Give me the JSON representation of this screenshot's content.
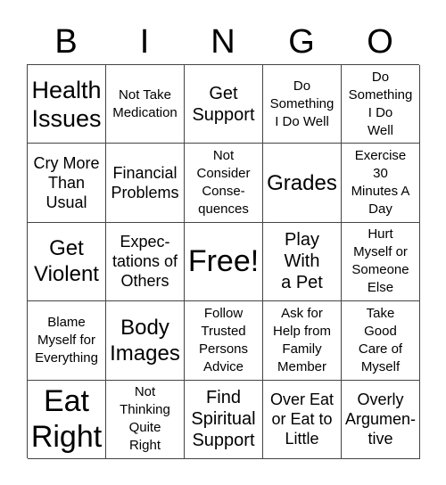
{
  "header": {
    "letters": [
      "B",
      "I",
      "N",
      "G",
      "O"
    ]
  },
  "grid": {
    "rows": [
      [
        "Health\nIssues",
        "Not Take\nMedication",
        "Get\nSupport",
        "Do\nSomething\nI Do Well",
        "Do\nSomething\nI Do\nWell"
      ],
      [
        "Cry More\nThan\nUsual",
        "Financial\nProblems",
        "Not\nConsider\nConse-\nquences",
        "Grades",
        "Exercise\n30\nMinutes A\nDay"
      ],
      [
        "Get\nViolent",
        "Expec-\ntations of\nOthers",
        "Free!",
        "Play\nWith\na Pet",
        "Hurt\nMyself or\nSomeone\nElse"
      ],
      [
        "Blame\nMyself for\nEverything",
        "Body\nImages",
        "Follow\nTrusted\nPersons\nAdvice",
        "Ask for\nHelp from\nFamily\nMember",
        "Take\nGood\nCare of\nMyself"
      ],
      [
        "Eat\nRight",
        "Not\nThinking\nQuite\nRight",
        "Find\nSpiritual\nSupport",
        "Over Eat\nor Eat to\nLittle",
        "Overly\nArgumen-\ntive"
      ]
    ]
  }
}
